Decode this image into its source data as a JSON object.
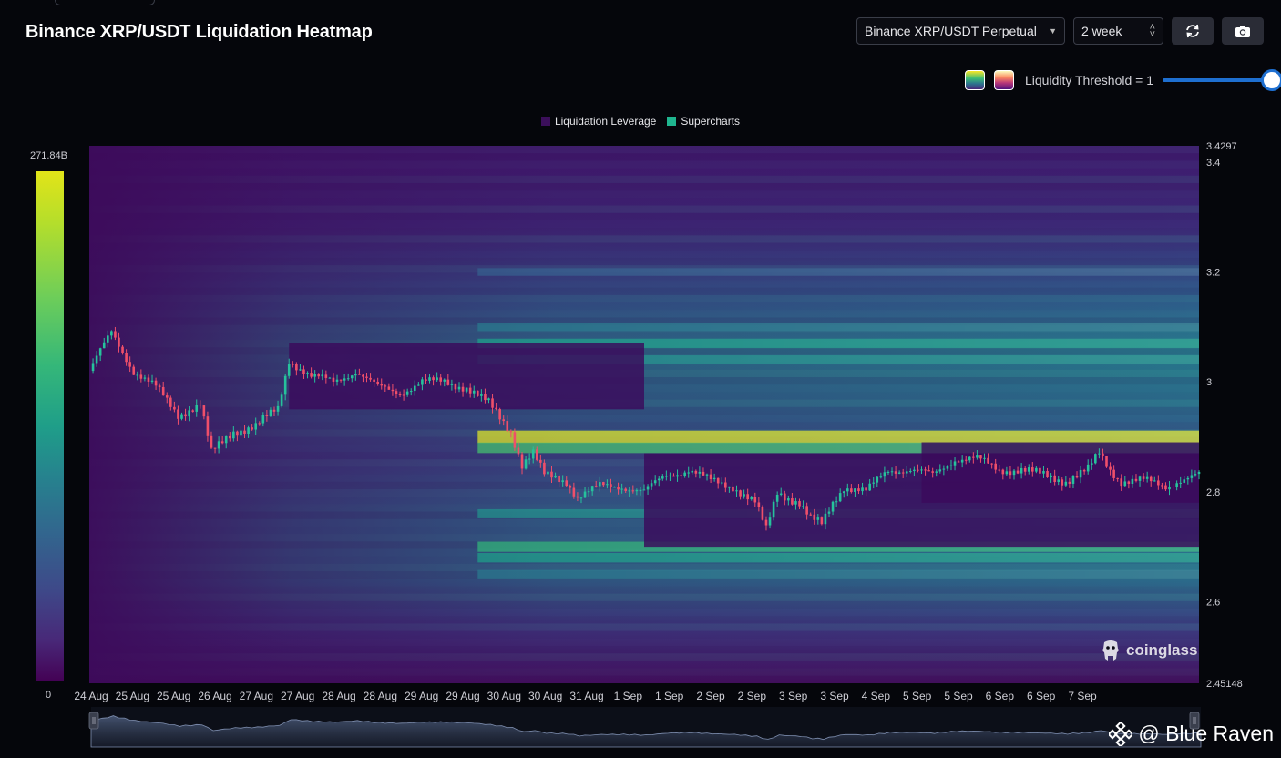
{
  "title": "Binance XRP/USDT Liquidation Heatmap",
  "controls": {
    "pair_select": "Binance XRP/USDT Perpetual",
    "range_select": "2 week",
    "refresh_icon": "refresh-icon",
    "screenshot_icon": "camera-icon"
  },
  "threshold": {
    "label": "Liquidity Threshold = 1",
    "value": 1.0,
    "palettes": [
      "viridis",
      "magma"
    ]
  },
  "legend": [
    {
      "label": "Liquidation Leverage",
      "color": "#3b0f5a"
    },
    {
      "label": "Supercharts",
      "color": "#1fb58f"
    }
  ],
  "colorbar": {
    "max_label": "271.84B",
    "min_label": "0"
  },
  "chart_data": {
    "type": "heatmap",
    "title": "Binance XRP/USDT Liquidation Heatmap",
    "x_ticks": [
      "24 Aug",
      "25 Aug",
      "25 Aug",
      "26 Aug",
      "27 Aug",
      "27 Aug",
      "28 Aug",
      "28 Aug",
      "29 Aug",
      "29 Aug",
      "30 Aug",
      "30 Aug",
      "31 Aug",
      "1 Sep",
      "1 Sep",
      "2 Sep",
      "2 Sep",
      "3 Sep",
      "3 Sep",
      "4 Sep",
      "5 Sep",
      "5 Sep",
      "6 Sep",
      "6 Sep",
      "7 Sep"
    ],
    "y_ticks": [
      "3.4297",
      "3.4",
      "3.2",
      "3",
      "2.8",
      "2.6",
      "2.45148"
    ],
    "ylim": [
      2.45148,
      3.4297
    ],
    "price_path": [
      [
        0,
        3.02
      ],
      [
        0.02,
        3.09
      ],
      [
        0.04,
        3.02
      ],
      [
        0.06,
        2.99
      ],
      [
        0.08,
        2.94
      ],
      [
        0.1,
        2.96
      ],
      [
        0.11,
        2.87
      ],
      [
        0.13,
        2.91
      ],
      [
        0.15,
        2.92
      ],
      [
        0.17,
        2.95
      ],
      [
        0.18,
        3.04
      ],
      [
        0.2,
        3.01
      ],
      [
        0.22,
        3.0
      ],
      [
        0.24,
        3.02
      ],
      [
        0.26,
        2.99
      ],
      [
        0.28,
        2.98
      ],
      [
        0.3,
        3.0
      ],
      [
        0.32,
        3.0
      ],
      [
        0.34,
        2.99
      ],
      [
        0.36,
        2.96
      ],
      [
        0.38,
        2.91
      ],
      [
        0.39,
        2.85
      ],
      [
        0.4,
        2.87
      ],
      [
        0.41,
        2.83
      ],
      [
        0.43,
        2.82
      ],
      [
        0.44,
        2.79
      ],
      [
        0.46,
        2.81
      ],
      [
        0.48,
        2.81
      ],
      [
        0.5,
        2.8
      ],
      [
        0.52,
        2.83
      ],
      [
        0.54,
        2.84
      ],
      [
        0.56,
        2.82
      ],
      [
        0.58,
        2.81
      ],
      [
        0.6,
        2.78
      ],
      [
        0.61,
        2.73
      ],
      [
        0.62,
        2.8
      ],
      [
        0.64,
        2.78
      ],
      [
        0.65,
        2.75
      ],
      [
        0.66,
        2.74
      ],
      [
        0.67,
        2.78
      ],
      [
        0.68,
        2.81
      ],
      [
        0.7,
        2.8
      ],
      [
        0.72,
        2.84
      ],
      [
        0.74,
        2.84
      ],
      [
        0.76,
        2.83
      ],
      [
        0.78,
        2.86
      ],
      [
        0.8,
        2.86
      ],
      [
        0.82,
        2.84
      ],
      [
        0.84,
        2.84
      ],
      [
        0.86,
        2.83
      ],
      [
        0.88,
        2.82
      ],
      [
        0.9,
        2.84
      ],
      [
        0.91,
        2.87
      ],
      [
        0.92,
        2.84
      ],
      [
        0.93,
        2.82
      ],
      [
        0.95,
        2.82
      ],
      [
        0.97,
        2.81
      ],
      [
        0.98,
        2.82
      ],
      [
        1.0,
        2.83
      ]
    ],
    "liquidity_bands": [
      {
        "price": 3.07,
        "intensity": 0.55
      },
      {
        "price": 3.04,
        "intensity": 0.5
      },
      {
        "price": 3.1,
        "intensity": 0.4
      },
      {
        "price": 2.9,
        "intensity": 0.95
      },
      {
        "price": 2.88,
        "intensity": 0.7
      },
      {
        "price": 2.7,
        "intensity": 0.65
      },
      {
        "price": 2.68,
        "intensity": 0.55
      },
      {
        "price": 2.76,
        "intensity": 0.5
      },
      {
        "price": 2.65,
        "intensity": 0.4
      },
      {
        "price": 3.2,
        "intensity": 0.3
      }
    ],
    "range_boxes": [
      {
        "x0": 0.18,
        "x1": 0.5,
        "top": 3.07,
        "bottom": 2.95
      },
      {
        "x0": 0.5,
        "x1": 1.0,
        "top": 2.87,
        "bottom": 2.7
      },
      {
        "x0": 0.75,
        "x1": 1.0,
        "top": 2.89,
        "bottom": 2.78
      }
    ]
  },
  "watermark": {
    "text": "coinglass",
    "icon": "coinglass-logo-icon"
  },
  "credit": {
    "text": "@ Blue Raven",
    "icon": "binance-diamond-icon"
  }
}
